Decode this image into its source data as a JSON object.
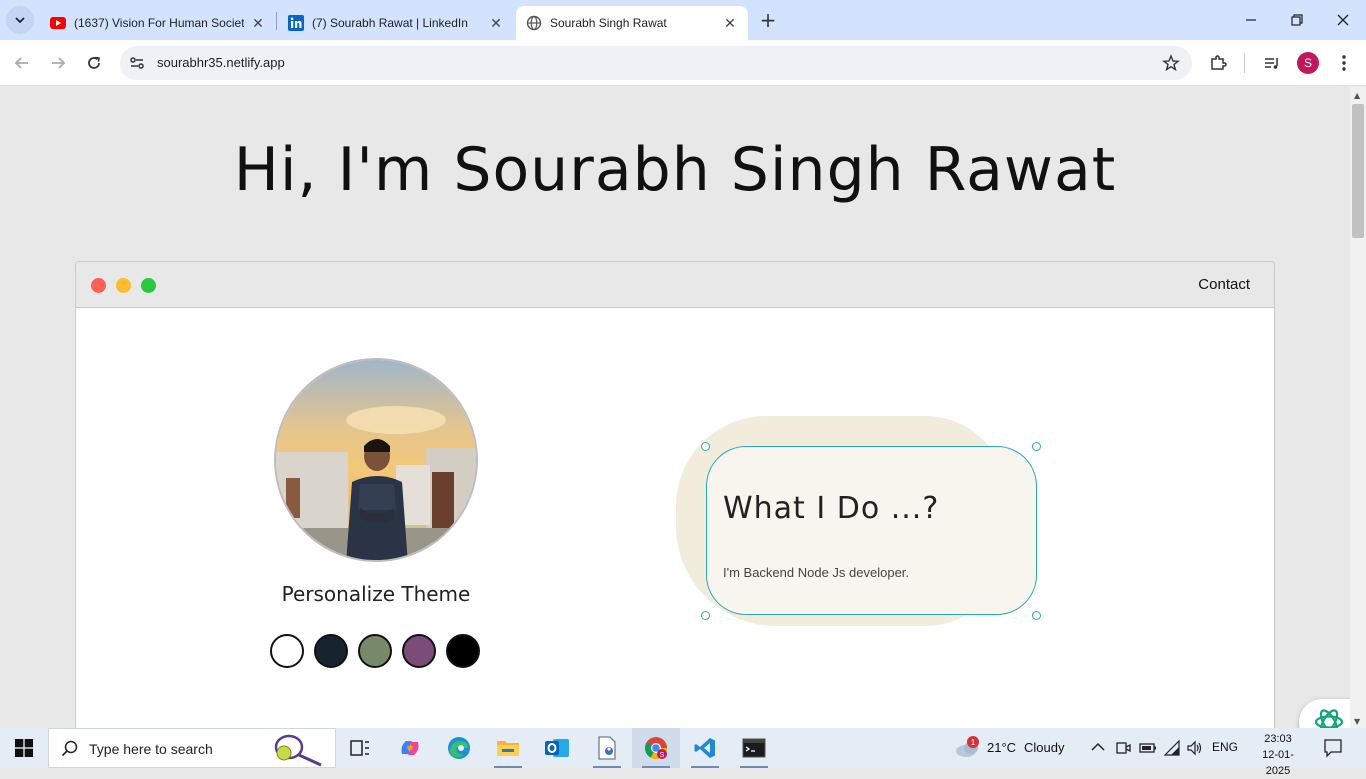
{
  "browser": {
    "tabs": [
      {
        "title": "(1637) Vision For Human Societ",
        "favicon": "youtube-icon",
        "active": false
      },
      {
        "title": "(7) Sourabh Rawat | LinkedIn",
        "favicon": "linkedin-icon",
        "active": false
      },
      {
        "title": "Sourabh Singh Rawat",
        "favicon": "globe-icon",
        "active": true
      }
    ],
    "url": "sourabhr35.netlify.app",
    "profile_initial": "S"
  },
  "page": {
    "hero_title": "Hi, I'm Sourabh Singh Rawat",
    "nav": {
      "contact": "Contact"
    },
    "window_dots": [
      "#ff5f57",
      "#febc2e",
      "#28c840"
    ],
    "theme": {
      "label": "Personalize Theme",
      "swatches": [
        "#ffffff",
        "#17242f",
        "#78896a",
        "#7b4b79",
        "#000000"
      ]
    },
    "card": {
      "title": "What I Do ...?",
      "text": "I'm Backend Node Js developer."
    }
  },
  "taskbar": {
    "search_placeholder": "Type here to search",
    "weather": {
      "temp": "21°C",
      "condition": "Cloudy",
      "badge": "1"
    },
    "language": "ENG",
    "time": "23:03",
    "date": "12-01-2025"
  }
}
